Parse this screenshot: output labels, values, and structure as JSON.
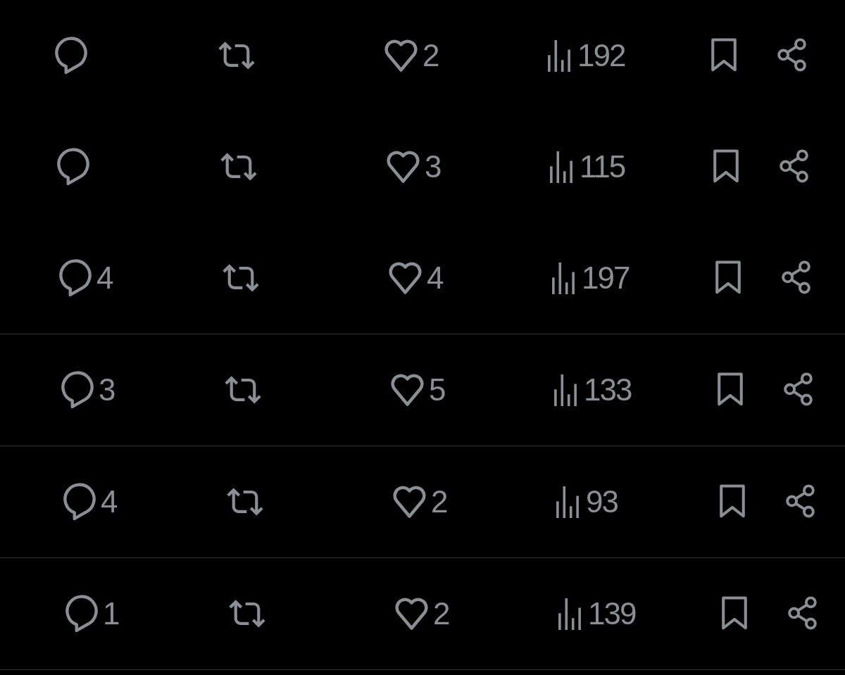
{
  "threads": [
    {
      "action_bars": [
        {
          "likes": "2",
          "views": "192"
        },
        {
          "likes": "3",
          "views": "115"
        },
        {
          "replies": "4",
          "likes": "4",
          "views": "197"
        }
      ]
    },
    {
      "action_bars": [
        {
          "replies": "3",
          "likes": "5",
          "views": "133"
        }
      ]
    },
    {
      "action_bars": [
        {
          "replies": "4",
          "likes": "2",
          "views": "93"
        }
      ]
    },
    {
      "action_bars": [
        {
          "replies": "1",
          "likes": "2",
          "views": "139"
        }
      ]
    }
  ]
}
